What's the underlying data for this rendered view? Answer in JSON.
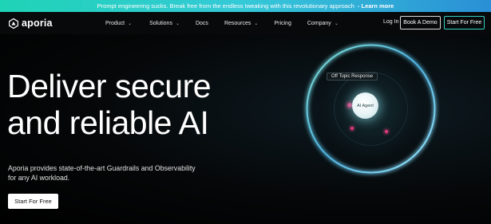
{
  "banner": {
    "text": "Prompt engineering sucks. Break free from the endless tweaking with this revolutionary approach",
    "cta": "- Learn more"
  },
  "brand": {
    "name": "aporia",
    "icon": "aporia-logo-icon"
  },
  "nav": {
    "items": [
      {
        "label": "Product",
        "has_dropdown": true
      },
      {
        "label": "Solutions",
        "has_dropdown": true
      },
      {
        "label": "Docs",
        "has_dropdown": false
      },
      {
        "label": "Resources",
        "has_dropdown": true
      },
      {
        "label": "Pricing",
        "has_dropdown": false
      },
      {
        "label": "Company",
        "has_dropdown": true
      }
    ],
    "chevron_glyph": "⌄",
    "login": "Log In",
    "demo": "Book A Demo",
    "start": "Start For Free"
  },
  "hero": {
    "headline_line1": "Deliver secure",
    "headline_line2": "and reliable AI",
    "subtext_line1": "Aporia provides state-of-the-art Guardrails and Observability",
    "subtext_line2": "for any AI workload.",
    "cta": "Start For Free"
  },
  "visual": {
    "label": "Off Topic Response",
    "agent": "AI Agent"
  },
  "colors": {
    "accent_teal": "#33d1c4",
    "accent_blue": "#2a8fd6",
    "background": "#000000",
    "dot_magenta": "#d63a7a"
  }
}
